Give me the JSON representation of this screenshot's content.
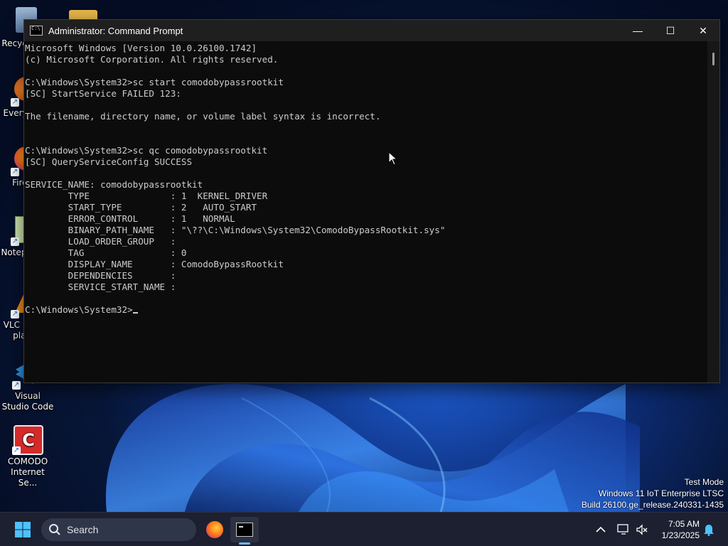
{
  "desktop": {
    "icons": [
      {
        "label": "Recycle Bin",
        "icon": "recycle-bin-icon"
      },
      {
        "label": "",
        "icon": "folder-icon"
      },
      {
        "label": "Everything",
        "icon": "everything-icon"
      },
      {
        "label": "Firefox",
        "icon": "firefox-icon"
      },
      {
        "label": "Notepad++",
        "icon": "notepad-plus-plus-icon"
      },
      {
        "label": "VLC media player",
        "icon": "vlc-icon"
      },
      {
        "label": "Visual Studio Code",
        "icon": "vscode-icon"
      },
      {
        "label": "COMODO Internet Se...",
        "icon": "comodo-icon"
      }
    ]
  },
  "window": {
    "title": "Administrator: Command Prompt",
    "minimize": "—",
    "maximize": "☐",
    "close": "✕"
  },
  "console": {
    "lines": [
      "Microsoft Windows [Version 10.0.26100.1742]",
      "(c) Microsoft Corporation. All rights reserved.",
      "",
      "C:\\Windows\\System32>sc start comodobypassrootkit",
      "[SC] StartService FAILED 123:",
      "",
      "The filename, directory name, or volume label syntax is incorrect.",
      "",
      "",
      "C:\\Windows\\System32>sc qc comodobypassrootkit",
      "[SC] QueryServiceConfig SUCCESS",
      "",
      "SERVICE_NAME: comodobypassrootkit",
      "        TYPE               : 1  KERNEL_DRIVER",
      "        START_TYPE         : 2   AUTO_START",
      "        ERROR_CONTROL      : 1   NORMAL",
      "        BINARY_PATH_NAME   : \"\\??\\C:\\Windows\\System32\\ComodoBypassRootkit.sys\"",
      "        LOAD_ORDER_GROUP   :",
      "        TAG                : 0",
      "        DISPLAY_NAME       : ComodoBypassRootkit",
      "        DEPENDENCIES       :",
      "        SERVICE_START_NAME :",
      ""
    ],
    "prompt": "C:\\Windows\\System32>"
  },
  "watermark": {
    "line1": "Test Mode",
    "line2": "Windows 11 IoT Enterprise LTSC",
    "line3": "Build 26100.ge_release.240331-1435"
  },
  "taskbar": {
    "search_label": "Search",
    "time": "7:05 AM",
    "date": "1/23/2025"
  },
  "colors": {
    "console_bg": "#0c0c0c",
    "console_text": "#cccccc",
    "taskbar_bg": "#1c2030",
    "accent": "#6cb8ff"
  }
}
